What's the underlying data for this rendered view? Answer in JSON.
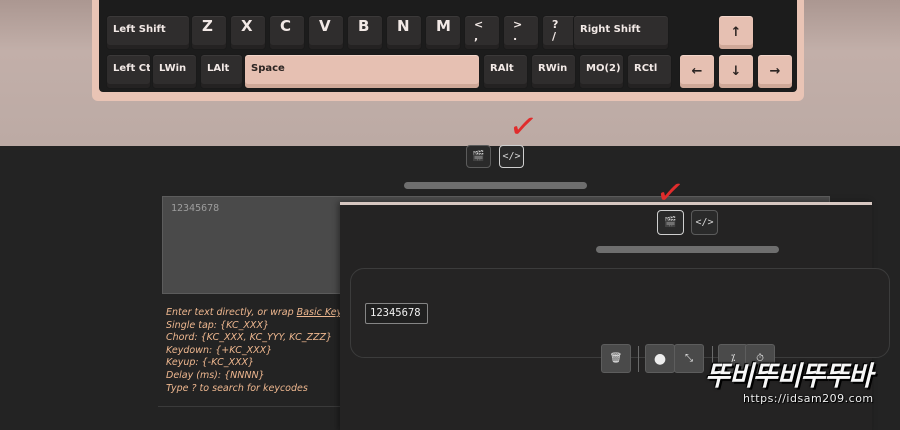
{
  "keyboard": {
    "row_shift": [
      "Left Shift",
      "Z",
      "X",
      "C",
      "V",
      "B",
      "N",
      "M",
      "<",
      ",",
      ">",
      ".",
      "?",
      "/",
      "Right Shift"
    ],
    "row_bottom": [
      "Left Ctrl",
      "LWin",
      "LAlt",
      "Space",
      "RAlt",
      "RWin",
      "MO(2)",
      "RCtl"
    ],
    "arrows": {
      "up": "↑",
      "left": "←",
      "down": "↓",
      "right": "→"
    }
  },
  "view_toggle": {
    "video_icon": "🎬",
    "code_icon": "</>"
  },
  "macro_text": {
    "value": "12345678"
  },
  "help": {
    "line1_prefix": "Enter text directly, or wrap ",
    "line1_link": "Basic Keycodes",
    "line2": "Single tap: {KC_XXX}",
    "line3": "Chord: {KC_XXX, KC_YYY, KC_ZZZ}",
    "line4": "Keydown: {+KC_XXX}",
    "line5": "Keyup: {-KC_XXX}",
    "line6": "Delay (ms): {NNNN}",
    "line7": "Type ? to search for keycodes"
  },
  "recorder": {
    "sequence_value": "12345678",
    "toolbar": {
      "delete_icon": "🗑",
      "record_icon": "●",
      "compress_icon": "⤡",
      "magic_icon": "⁒",
      "timer_icon": "⏱"
    }
  },
  "watermark": {
    "logo": "뚜비뚜비뚜뚜바",
    "url": "https://idsam209.com"
  },
  "colors": {
    "accent": "#e9c4b5",
    "check": "#e02c2c",
    "help_text": "#eeb78f"
  }
}
